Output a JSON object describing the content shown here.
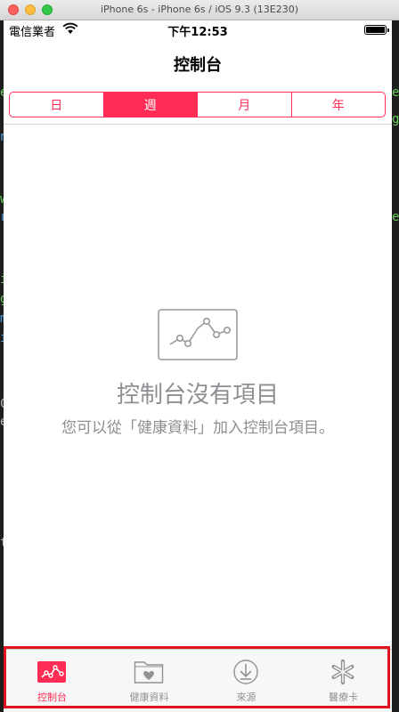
{
  "window": {
    "title": "iPhone 6s - iPhone 6s / iOS 9.3 (13E230)"
  },
  "status_bar": {
    "carrier": "電信業者",
    "time": "下午12:53"
  },
  "nav": {
    "title": "控制台"
  },
  "segments": [
    {
      "label": "日",
      "selected": false
    },
    {
      "label": "週",
      "selected": true
    },
    {
      "label": "月",
      "selected": false
    },
    {
      "label": "年",
      "selected": false
    }
  ],
  "empty_state": {
    "icon": "chart-icon",
    "title": "控制台沒有項目",
    "message": "您可以從「健康資料」加入控制台項目。"
  },
  "tabs": [
    {
      "label": "控制台",
      "icon": "dashboard-icon",
      "active": true
    },
    {
      "label": "健康資料",
      "icon": "health-data-folder-icon",
      "active": false
    },
    {
      "label": "來源",
      "icon": "sources-download-icon",
      "active": false
    },
    {
      "label": "醫療卡",
      "icon": "medical-id-asterisk-icon",
      "active": false
    }
  ],
  "colors": {
    "accent": "#ff2d55",
    "highlight_border": "#e0131f",
    "inactive": "#929292"
  }
}
